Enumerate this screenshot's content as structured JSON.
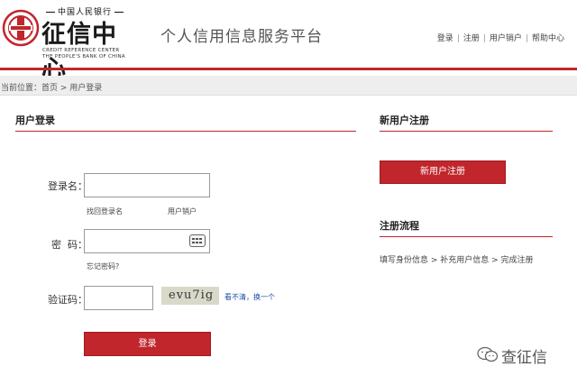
{
  "header": {
    "logo_top": "中国人民银行",
    "logo_main": "征信中心",
    "logo_en_line1": "CREDIT REFERENCE CENTER",
    "logo_en_line2": "THE PEOPLE'S BANK OF CHINA",
    "platform_title": "个人信用信息服务平台",
    "links": [
      "登录",
      "注册",
      "用户销户",
      "帮助中心"
    ]
  },
  "breadcrumb": "当前位置：首页 > 用户登录",
  "login": {
    "title": "用户登录",
    "username_label": "登录名：",
    "username_value": "",
    "find_username": "找回登录名",
    "cancel_account": "用户销户",
    "password_label": "密  码：",
    "password_value": "",
    "forgot_password": "忘记密码?",
    "captcha_label": "验证码：",
    "captcha_value": "",
    "captcha_text": "evu7ig",
    "refresh_text": "看不清，换一个",
    "submit": "登录"
  },
  "register": {
    "title": "新用户注册",
    "button": "新用户注册",
    "flow_title": "注册流程",
    "flow_steps": "填写身份信息 > 补充用户信息 > 完成注册"
  },
  "watermark": "查征信",
  "colors": {
    "accent": "#c0262c"
  }
}
